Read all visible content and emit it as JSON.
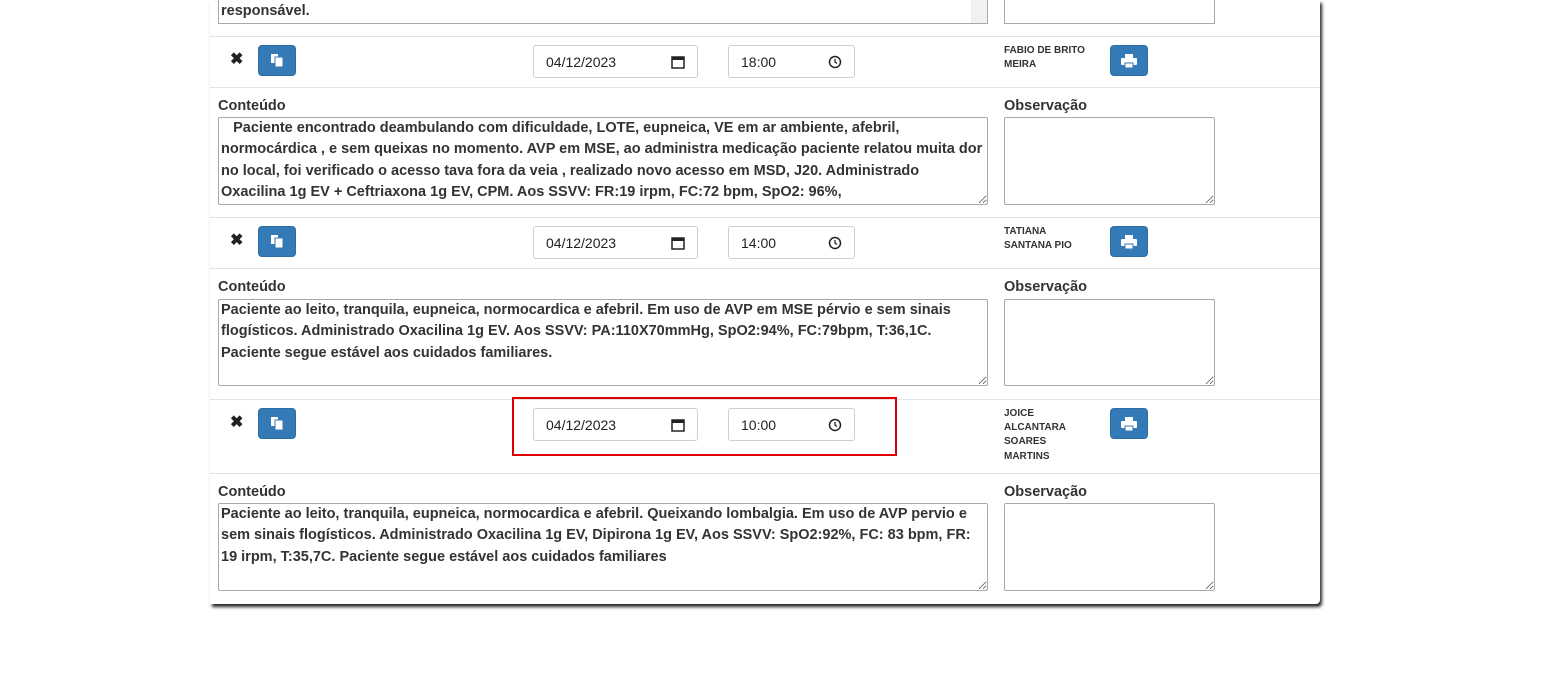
{
  "labels": {
    "conteudo": "Conteúdo",
    "observacao": "Observação"
  },
  "top_partial": {
    "text": "responsável."
  },
  "records": [
    {
      "date": "04/12/2023",
      "time": "18:00",
      "author_lines": [
        "FABIO DE BRITO",
        "MEIRA"
      ],
      "conteudo": "   Paciente encontrado deambulando com dificuldade, LOTE, eupneica, VE em ar ambiente, afebril, normocárdica , e sem queixas no momento. AVP em MSE, ao administra medicação paciente relatou muita dor no local, foi verificado o acesso tava fora da veia , realizado novo acesso em MSD, J20. Administrado Oxacilina 1g EV + Ceftriaxona 1g EV, CPM. Aos SSVV: FR:19 irpm, FC:72 bpm, SpO2: 96%,",
      "observacao": ""
    },
    {
      "date": "04/12/2023",
      "time": "14:00",
      "author_lines": [
        "TATIANA",
        "SANTANA PIO"
      ],
      "conteudo": "Paciente ao leito, tranquila, eupneica, normocardica e afebril. Em uso de AVP em MSE pérvio e sem sinais flogísticos. Administrado Oxacilina 1g EV. Aos SSVV: PA:110X70mmHg, SpO2:94%, FC:79bpm, T:36,1C. Paciente segue estável aos cuidados familiares.",
      "observacao": ""
    },
    {
      "date": "04/12/2023",
      "time": "10:00",
      "author_lines": [
        "JOICE",
        "ALCANTARA",
        "SOARES",
        "MARTINS"
      ],
      "conteudo": "Paciente ao leito, tranquila, eupneica, normocardica e afebril. Queixando lombalgia. Em uso de AVP pervio e sem sinais flogísticos. Administrado Oxacilina 1g EV, Dipirona 1g EV, Aos SSVV: SpO2:92%, FC: 83 bpm, FR: 19 irpm, T:35,7C. Paciente segue estável aos cuidados familiares",
      "observacao": ""
    }
  ],
  "icons": {
    "delete": "close-icon",
    "copy": "copy-icon",
    "print": "print-icon",
    "calendar": "calendar-icon",
    "clock": "clock-icon"
  },
  "colors": {
    "button_blue": "#337ab7",
    "highlight": "#e00000"
  }
}
